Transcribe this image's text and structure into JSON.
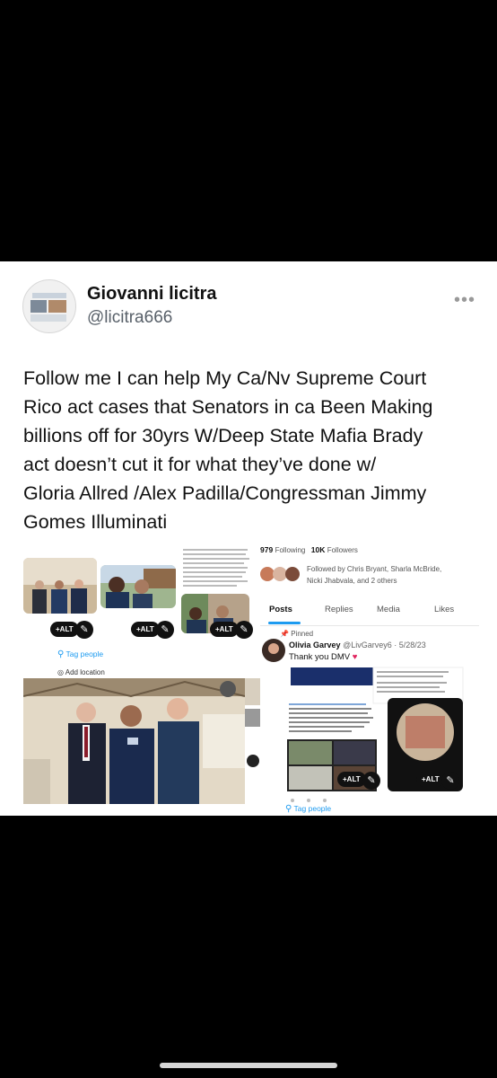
{
  "tweet": {
    "display_name": "Giovanni licitra",
    "handle": "@licitra666",
    "more_label": "•••",
    "text_lines": [
      "Follow me I can help My Ca/Nv Supreme Court",
      "Rico act cases that Senators in ca Been Making",
      "billions off for 30yrs W/Deep State Mafia Brady",
      "act doesn’t cut it for what they’ve done w/",
      "Gloria Allred /Alex Padilla/Congressman Jimmy",
      "Gomes Illuminati"
    ]
  },
  "left_panel": {
    "alt_label": "+ALT",
    "tag_people": "Tag people",
    "add_location": "Add location"
  },
  "right_panel": {
    "following_count": "979",
    "following_label": "Following",
    "followers_count": "10K",
    "followers_label": "Followers",
    "followed_by": "Followed by Chris Bryant, Sharla McBride,",
    "followed_by_2": "Nicki Jhabvala, and 2 others",
    "tabs": [
      "Posts",
      "Replies",
      "Media",
      "Likes"
    ],
    "pinned_label": "Pinned",
    "pinned_author": "Olivia Garvey",
    "pinned_handle_date": "@LivGarvey6 · 5/28/23",
    "pinned_text": "Thank you DMV",
    "alt_label": "+ALT",
    "tag_people": "Tag people"
  },
  "colors": {
    "accent": "#1d9bf0",
    "background": "#000000",
    "card": "#ffffff"
  }
}
